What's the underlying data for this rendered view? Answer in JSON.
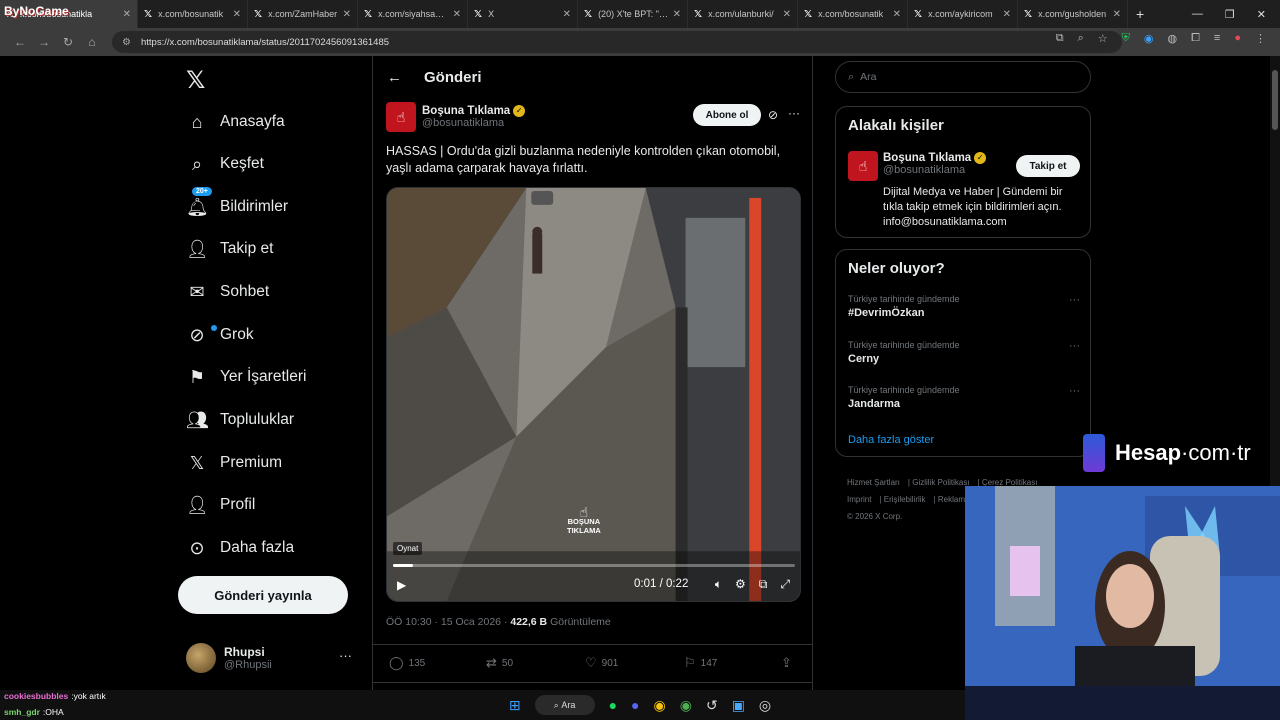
{
  "browser": {
    "tabs": [
      {
        "label": "x.com/bosunatikla",
        "active": false
      },
      {
        "label": "x.com/bosunatik",
        "active": false
      },
      {
        "label": "x.com/ZamHaber",
        "active": false
      },
      {
        "label": "x.com/siyahsanca",
        "active": false
      },
      {
        "label": "X",
        "active": false
      },
      {
        "label": "(20) X'te BPT: \"İstı",
        "active": false
      },
      {
        "label": "x.com/ulanburki/",
        "active": false
      },
      {
        "label": "x.com/bosunatik",
        "active": false
      },
      {
        "label": "x.com/aykiricom",
        "active": false
      },
      {
        "label": "x.com/gusholden",
        "active": false
      }
    ],
    "url": "https://x.com/bosunatiklama/status/2011702456091361485"
  },
  "stream": {
    "logo_text": "ByNoGame",
    "sponsor_name": "Hesap",
    "sponsor_domain": "com",
    "sponsor_tld": "tr"
  },
  "nav": {
    "items": [
      {
        "label": "Anasayfa",
        "icon": "home-icon"
      },
      {
        "label": "Keşfet",
        "icon": "search-icon"
      },
      {
        "label": "Bildirimler",
        "icon": "bell-icon",
        "badge": "20+"
      },
      {
        "label": "Takip et",
        "icon": "follow-icon"
      },
      {
        "label": "Sohbet",
        "icon": "mail-icon"
      },
      {
        "label": "Grok",
        "icon": "grok-icon"
      },
      {
        "label": "Yer İşaretleri",
        "icon": "bookmark-icon"
      },
      {
        "label": "Topluluklar",
        "icon": "communities-icon"
      },
      {
        "label": "Premium",
        "icon": "x-icon"
      },
      {
        "label": "Profil",
        "icon": "profile-icon"
      },
      {
        "label": "Daha fazla",
        "icon": "more-circle-icon"
      }
    ],
    "post_button": "Gönderi yayınla",
    "user": {
      "name": "Rhupsi",
      "handle": "@Rhupsii"
    }
  },
  "post": {
    "header_title": "Gönderi",
    "author_name": "Boşuna Tıklama",
    "author_handle": "@bosunatiklama",
    "subscribe_label": "Abone ol",
    "text": "HASSAS | Ordu'da gizli buzlanma nedeniyle kontrolden çıkan otomobil, yaşlı adama çarparak havaya fırlattı.",
    "video": {
      "watermark_line1": "BOŞUNA",
      "watermark_line2": "TIKLAMA",
      "play_tooltip": "Oynat",
      "time": "0:01 / 0:22",
      "progress": 0.05
    },
    "time": "ÖÖ 10:30",
    "date": "15 Oca 2026",
    "views_value": "422,6 B",
    "views_label": "Görüntüleme",
    "replies": "135",
    "reposts": "50",
    "likes": "901",
    "bookmarks": "147"
  },
  "right": {
    "search_placeholder": "Ara",
    "related_title": "Alakalı kişiler",
    "related": {
      "name": "Boşuna Tıklama",
      "handle": "@bosunatiklama",
      "follow_label": "Takip et",
      "bio": "Dijital Medya ve Haber | Gündemi bir tıkla takip etmek için bildirimleri açın. info@bosunatiklama.com"
    },
    "trends_title": "Neler oluyor?",
    "trends": [
      {
        "context": "Türkiye tarihinde gündemde",
        "name": "#DevrimÖzkan"
      },
      {
        "context": "Türkiye tarihinde gündemde",
        "name": "Cerny"
      },
      {
        "context": "Türkiye tarihinde gündemde",
        "name": "Jandarma"
      }
    ],
    "show_more": "Daha fazla göster",
    "footer": {
      "links1": [
        "Hizmet Şartları",
        "Gizlilik Politikası",
        "Çerez Politikası"
      ],
      "links2": [
        "Imprint",
        "Erişilebilirlik",
        "Reklam"
      ],
      "copyright": "© 2026 X Corp."
    }
  },
  "chat": [
    {
      "user": "cookiesbubbles",
      "message": "yok artık"
    },
    {
      "user": "smh_gdr",
      "message": "OHA"
    }
  ],
  "taskbar": {
    "search_label": "Ara"
  },
  "colors": {
    "accent": "#1d9bf0",
    "background": "#000000",
    "border": "#2f3336",
    "muted": "#71767b"
  }
}
